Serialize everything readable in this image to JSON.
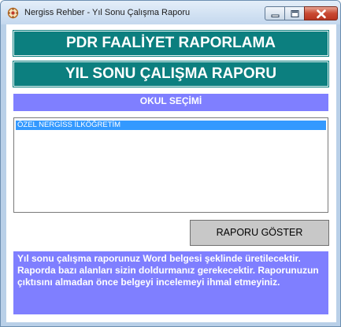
{
  "window": {
    "title": "Nergiss Rehber - Yıl Sonu Çalışma Raporu",
    "controls": {
      "minimize_icon": "minimize-icon",
      "maximize_icon": "maximize-icon",
      "close_icon": "close-icon"
    }
  },
  "headers": {
    "main": "PDR FAALİYET RAPORLAMA",
    "sub": "YIL SONU ÇALIŞMA RAPORU"
  },
  "school_section": {
    "title": "OKUL SEÇİMİ",
    "items": [
      {
        "label": "ÖZEL NERGİSS İLKÖĞRETİM",
        "selected": true
      }
    ]
  },
  "show_button": {
    "label": "RAPORU GÖSTER"
  },
  "info": {
    "text": "Yıl sonu çalışma raporunuz Word belgesi şeklinde üretilecektir. Raporda bazı alanları sizin doldurmanız gerekecektir. Raporunuzun çıktısını almadan önce belgeyi incelemeyi ihmal etmeyiniz."
  },
  "colors": {
    "teal": "#0c7f7f",
    "periwinkle": "#7f7fff",
    "selection": "#3399ff",
    "button_gray": "#c8c8c8"
  }
}
